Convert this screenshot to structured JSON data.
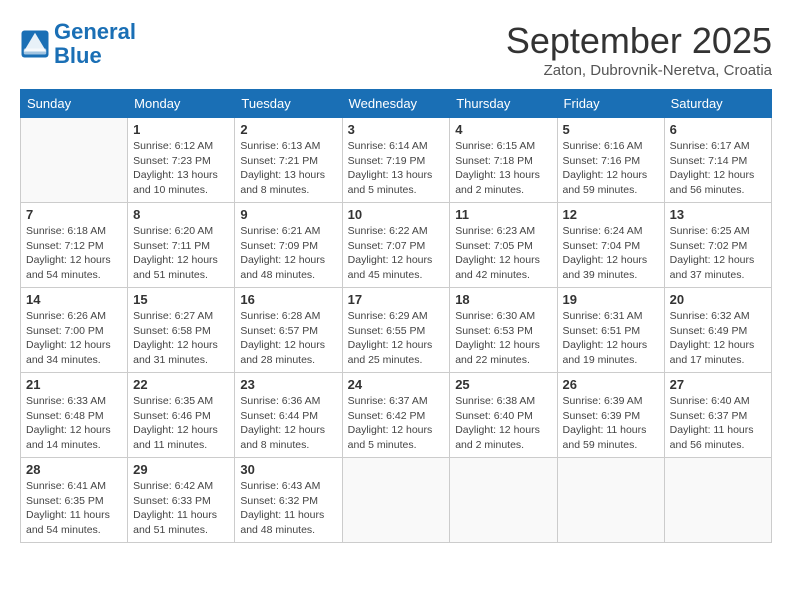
{
  "header": {
    "logo_line1": "General",
    "logo_line2": "Blue",
    "month_title": "September 2025",
    "subtitle": "Zaton, Dubrovnik-Neretva, Croatia"
  },
  "weekdays": [
    "Sunday",
    "Monday",
    "Tuesday",
    "Wednesday",
    "Thursday",
    "Friday",
    "Saturday"
  ],
  "weeks": [
    [
      {
        "day": "",
        "sunrise": "",
        "sunset": "",
        "daylight": ""
      },
      {
        "day": "1",
        "sunrise": "Sunrise: 6:12 AM",
        "sunset": "Sunset: 7:23 PM",
        "daylight": "Daylight: 13 hours and 10 minutes."
      },
      {
        "day": "2",
        "sunrise": "Sunrise: 6:13 AM",
        "sunset": "Sunset: 7:21 PM",
        "daylight": "Daylight: 13 hours and 8 minutes."
      },
      {
        "day": "3",
        "sunrise": "Sunrise: 6:14 AM",
        "sunset": "Sunset: 7:19 PM",
        "daylight": "Daylight: 13 hours and 5 minutes."
      },
      {
        "day": "4",
        "sunrise": "Sunrise: 6:15 AM",
        "sunset": "Sunset: 7:18 PM",
        "daylight": "Daylight: 13 hours and 2 minutes."
      },
      {
        "day": "5",
        "sunrise": "Sunrise: 6:16 AM",
        "sunset": "Sunset: 7:16 PM",
        "daylight": "Daylight: 12 hours and 59 minutes."
      },
      {
        "day": "6",
        "sunrise": "Sunrise: 6:17 AM",
        "sunset": "Sunset: 7:14 PM",
        "daylight": "Daylight: 12 hours and 56 minutes."
      }
    ],
    [
      {
        "day": "7",
        "sunrise": "Sunrise: 6:18 AM",
        "sunset": "Sunset: 7:12 PM",
        "daylight": "Daylight: 12 hours and 54 minutes."
      },
      {
        "day": "8",
        "sunrise": "Sunrise: 6:20 AM",
        "sunset": "Sunset: 7:11 PM",
        "daylight": "Daylight: 12 hours and 51 minutes."
      },
      {
        "day": "9",
        "sunrise": "Sunrise: 6:21 AM",
        "sunset": "Sunset: 7:09 PM",
        "daylight": "Daylight: 12 hours and 48 minutes."
      },
      {
        "day": "10",
        "sunrise": "Sunrise: 6:22 AM",
        "sunset": "Sunset: 7:07 PM",
        "daylight": "Daylight: 12 hours and 45 minutes."
      },
      {
        "day": "11",
        "sunrise": "Sunrise: 6:23 AM",
        "sunset": "Sunset: 7:05 PM",
        "daylight": "Daylight: 12 hours and 42 minutes."
      },
      {
        "day": "12",
        "sunrise": "Sunrise: 6:24 AM",
        "sunset": "Sunset: 7:04 PM",
        "daylight": "Daylight: 12 hours and 39 minutes."
      },
      {
        "day": "13",
        "sunrise": "Sunrise: 6:25 AM",
        "sunset": "Sunset: 7:02 PM",
        "daylight": "Daylight: 12 hours and 37 minutes."
      }
    ],
    [
      {
        "day": "14",
        "sunrise": "Sunrise: 6:26 AM",
        "sunset": "Sunset: 7:00 PM",
        "daylight": "Daylight: 12 hours and 34 minutes."
      },
      {
        "day": "15",
        "sunrise": "Sunrise: 6:27 AM",
        "sunset": "Sunset: 6:58 PM",
        "daylight": "Daylight: 12 hours and 31 minutes."
      },
      {
        "day": "16",
        "sunrise": "Sunrise: 6:28 AM",
        "sunset": "Sunset: 6:57 PM",
        "daylight": "Daylight: 12 hours and 28 minutes."
      },
      {
        "day": "17",
        "sunrise": "Sunrise: 6:29 AM",
        "sunset": "Sunset: 6:55 PM",
        "daylight": "Daylight: 12 hours and 25 minutes."
      },
      {
        "day": "18",
        "sunrise": "Sunrise: 6:30 AM",
        "sunset": "Sunset: 6:53 PM",
        "daylight": "Daylight: 12 hours and 22 minutes."
      },
      {
        "day": "19",
        "sunrise": "Sunrise: 6:31 AM",
        "sunset": "Sunset: 6:51 PM",
        "daylight": "Daylight: 12 hours and 19 minutes."
      },
      {
        "day": "20",
        "sunrise": "Sunrise: 6:32 AM",
        "sunset": "Sunset: 6:49 PM",
        "daylight": "Daylight: 12 hours and 17 minutes."
      }
    ],
    [
      {
        "day": "21",
        "sunrise": "Sunrise: 6:33 AM",
        "sunset": "Sunset: 6:48 PM",
        "daylight": "Daylight: 12 hours and 14 minutes."
      },
      {
        "day": "22",
        "sunrise": "Sunrise: 6:35 AM",
        "sunset": "Sunset: 6:46 PM",
        "daylight": "Daylight: 12 hours and 11 minutes."
      },
      {
        "day": "23",
        "sunrise": "Sunrise: 6:36 AM",
        "sunset": "Sunset: 6:44 PM",
        "daylight": "Daylight: 12 hours and 8 minutes."
      },
      {
        "day": "24",
        "sunrise": "Sunrise: 6:37 AM",
        "sunset": "Sunset: 6:42 PM",
        "daylight": "Daylight: 12 hours and 5 minutes."
      },
      {
        "day": "25",
        "sunrise": "Sunrise: 6:38 AM",
        "sunset": "Sunset: 6:40 PM",
        "daylight": "Daylight: 12 hours and 2 minutes."
      },
      {
        "day": "26",
        "sunrise": "Sunrise: 6:39 AM",
        "sunset": "Sunset: 6:39 PM",
        "daylight": "Daylight: 11 hours and 59 minutes."
      },
      {
        "day": "27",
        "sunrise": "Sunrise: 6:40 AM",
        "sunset": "Sunset: 6:37 PM",
        "daylight": "Daylight: 11 hours and 56 minutes."
      }
    ],
    [
      {
        "day": "28",
        "sunrise": "Sunrise: 6:41 AM",
        "sunset": "Sunset: 6:35 PM",
        "daylight": "Daylight: 11 hours and 54 minutes."
      },
      {
        "day": "29",
        "sunrise": "Sunrise: 6:42 AM",
        "sunset": "Sunset: 6:33 PM",
        "daylight": "Daylight: 11 hours and 51 minutes."
      },
      {
        "day": "30",
        "sunrise": "Sunrise: 6:43 AM",
        "sunset": "Sunset: 6:32 PM",
        "daylight": "Daylight: 11 hours and 48 minutes."
      },
      {
        "day": "",
        "sunrise": "",
        "sunset": "",
        "daylight": ""
      },
      {
        "day": "",
        "sunrise": "",
        "sunset": "",
        "daylight": ""
      },
      {
        "day": "",
        "sunrise": "",
        "sunset": "",
        "daylight": ""
      },
      {
        "day": "",
        "sunrise": "",
        "sunset": "",
        "daylight": ""
      }
    ]
  ]
}
